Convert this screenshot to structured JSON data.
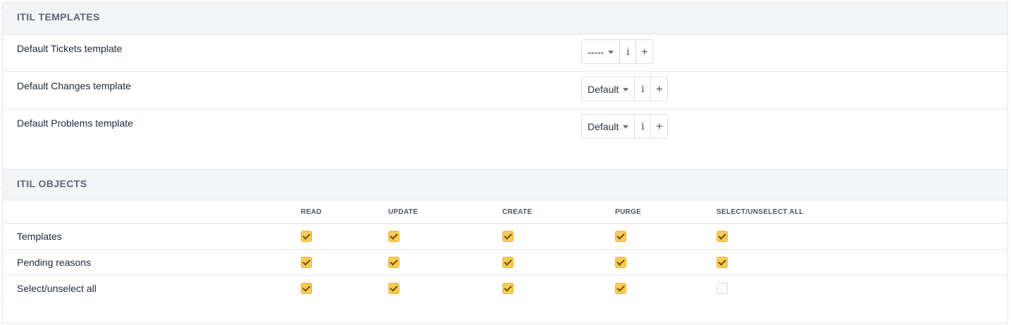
{
  "itil_templates": {
    "title": "ITIL TEMPLATES",
    "rows": [
      {
        "label": "Default Tickets template",
        "value": "-----"
      },
      {
        "label": "Default Changes template",
        "value": "Default"
      },
      {
        "label": "Default Problems template",
        "value": "Default"
      }
    ],
    "info_glyph": "i",
    "add_glyph": "+"
  },
  "itil_objects": {
    "title": "ITIL OBJECTS",
    "columns": [
      "READ",
      "UPDATE",
      "CREATE",
      "PURGE",
      "SELECT/UNSELECT ALL"
    ],
    "rows": [
      {
        "label": "Templates",
        "checked": [
          true,
          true,
          true,
          true,
          true
        ]
      },
      {
        "label": "Pending reasons",
        "checked": [
          true,
          true,
          true,
          true,
          true
        ]
      },
      {
        "label": "Select/unselect all",
        "checked": [
          true,
          true,
          true,
          true,
          false
        ]
      }
    ]
  },
  "colors": {
    "checkbox_checked": "#f8cb57",
    "section_header_bg": "#f3f4f6"
  }
}
